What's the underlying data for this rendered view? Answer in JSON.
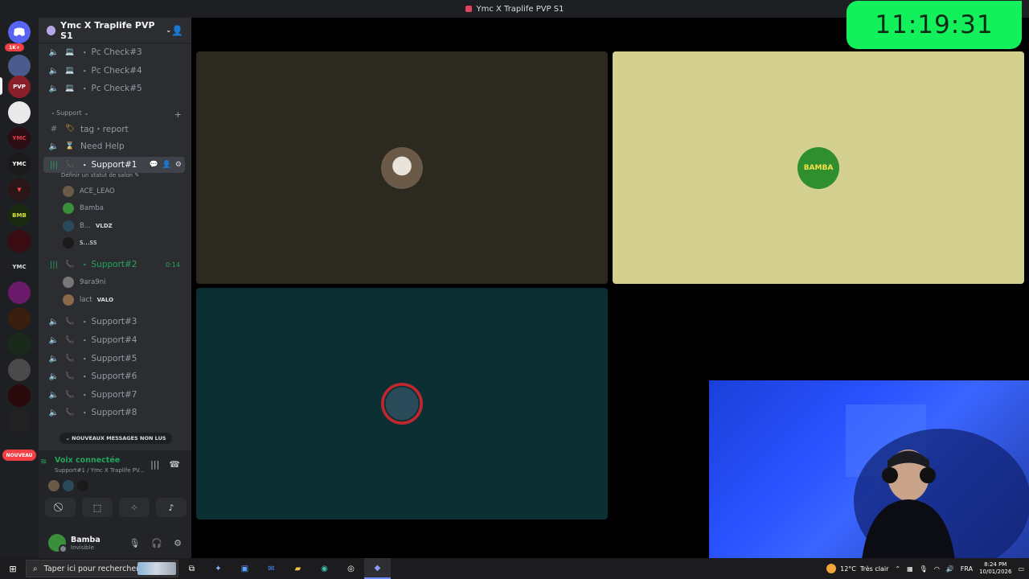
{
  "window": {
    "title": "Ymc X Traplife PVP S1"
  },
  "rail": {
    "badge_1k": "1K+",
    "nouveau": "NOUVEAU"
  },
  "server": {
    "name": "Ymc X Traplife PVP S1"
  },
  "channels_top": [
    {
      "label": "Pc Check#3"
    },
    {
      "label": "Pc Check#4"
    },
    {
      "label": "Pc Check#5"
    }
  ],
  "category": {
    "label": "Support"
  },
  "text_channel": {
    "label": "tag・report"
  },
  "need_help": {
    "label": "Need Help"
  },
  "support1": {
    "label": "Support#1",
    "status": "Définir un statut de salon",
    "users": [
      {
        "name": "ACE_LEAO",
        "tag": ""
      },
      {
        "name": "Bamba",
        "tag": ""
      },
      {
        "name": "B...",
        "tag": "VLDZ"
      },
      {
        "name": "s...ss",
        "tag": ""
      }
    ]
  },
  "support2": {
    "label": "Support#2",
    "timer": "0:14",
    "users": [
      {
        "name": "9ara9ni",
        "tag": ""
      },
      {
        "name": "lact",
        "tag": "VALO"
      }
    ]
  },
  "support_rest": [
    {
      "label": "Support#3"
    },
    {
      "label": "Support#4"
    },
    {
      "label": "Support#5"
    },
    {
      "label": "Support#6"
    },
    {
      "label": "Support#7"
    },
    {
      "label": "Support#8"
    }
  ],
  "unread": "NOUVEAUX MESSAGES NON LUS",
  "voice": {
    "connected": "Voix connectée",
    "location": "Support#1 / Ymc X Traplife PV..."
  },
  "user": {
    "name": "Bamba",
    "status": "Invisible"
  },
  "overlay_clock": "11:19:31",
  "taskbar": {
    "search_placeholder": "Taper ici pour rechercher",
    "temp": "12°C",
    "weather": "Très clair",
    "lang": "FRA",
    "time": "8:24 PM",
    "date": "10/01/2026"
  },
  "colors": {
    "tile1": "#2c2920",
    "tile2": "#d4d090",
    "tile3": "#0c2f34",
    "clock_bg": "#12f05c",
    "green": "#23a55a"
  }
}
